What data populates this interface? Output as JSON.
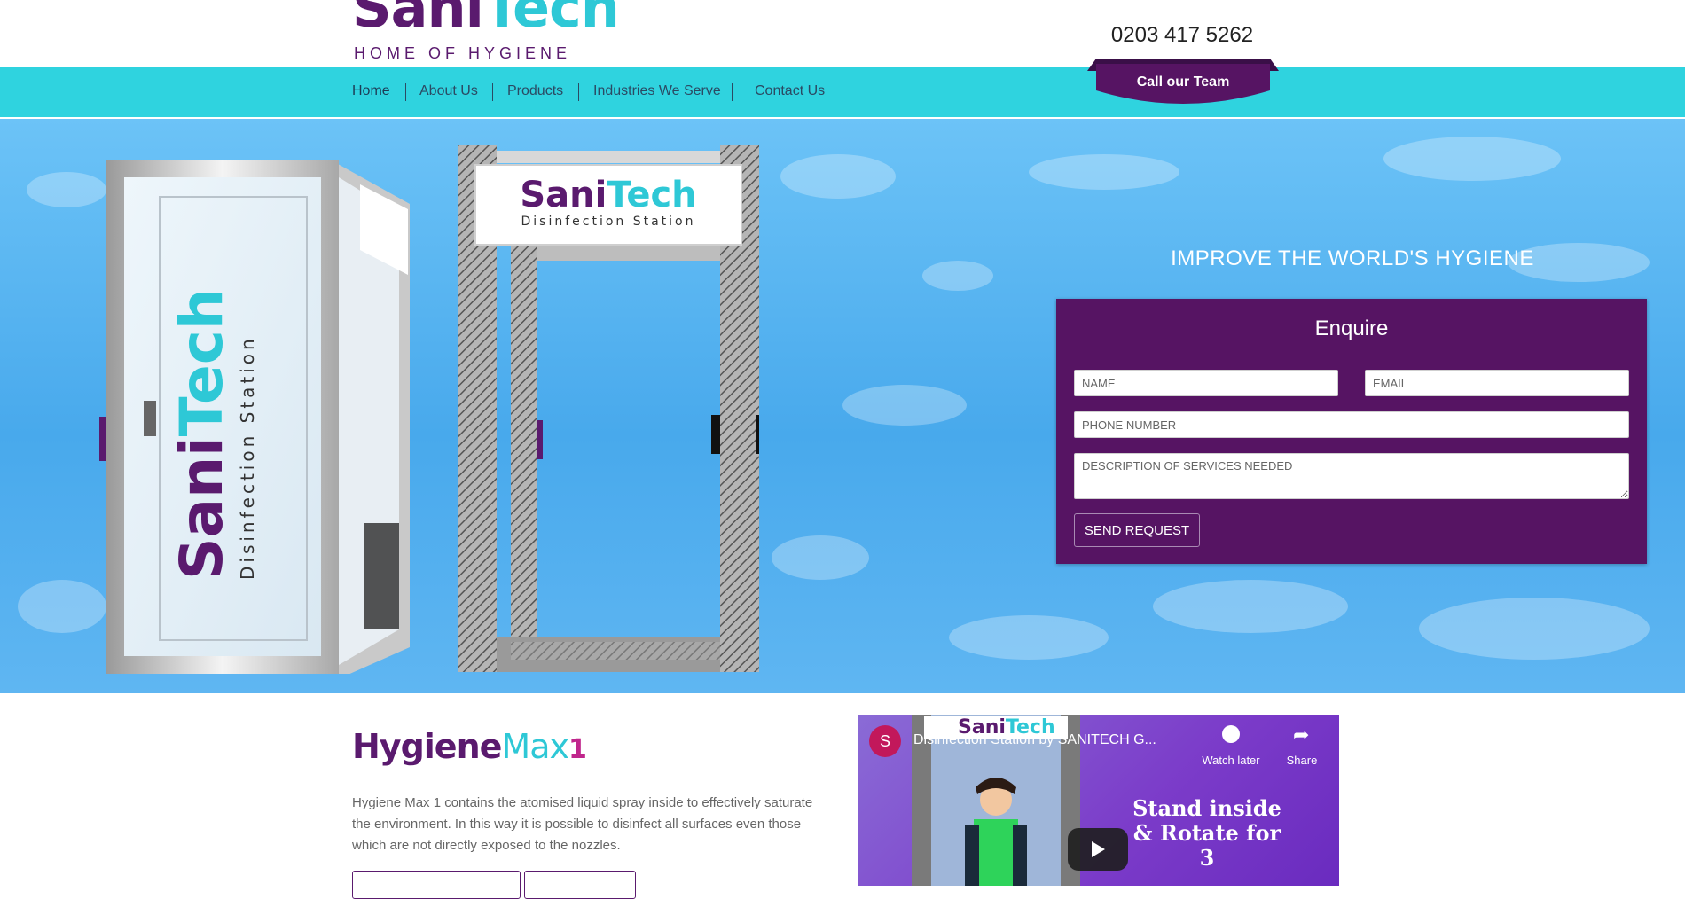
{
  "header": {
    "logo_brand_1": "Sani",
    "logo_brand_2": "Tech",
    "logo_tagline": "HOME OF HYGIENE",
    "phone": "0203 417 5262",
    "call_button": "Call our Team"
  },
  "nav": {
    "items": [
      {
        "label": "Home"
      },
      {
        "label": "About Us"
      },
      {
        "label": "Products"
      },
      {
        "label": "Industries We Serve"
      },
      {
        "label": "Contact Us"
      }
    ]
  },
  "hero": {
    "title": "IMPROVE THE WORLD'S HYGIENE",
    "booth_left": {
      "brand_1": "Sani",
      "brand_2": "Tech",
      "subtitle": "Disinfection Station"
    },
    "booth_right": {
      "brand_1": "Sani",
      "brand_2": "Tech",
      "subtitle": "Disinfection Station"
    }
  },
  "enquire": {
    "title": "Enquire",
    "name_placeholder": "NAME",
    "email_placeholder": "EMAIL",
    "phone_placeholder": "PHONE NUMBER",
    "description_placeholder": "DESCRIPTION OF SERVICES NEEDED",
    "submit_label": "SEND REQUEST"
  },
  "product": {
    "name_1": "Hygiene",
    "name_2": "Max",
    "name_3": "1",
    "description": "Hygiene Max 1 contains the atomised liquid spray inside to effectively saturate the environment. In this way it is possible to disinfect all surfaces even those which are not directly exposed to the nozzles."
  },
  "video": {
    "channel_initial": "S",
    "title": "Disinfection Station by SANITECH G...",
    "watch_later": "Watch later",
    "share": "Share",
    "caption_line1": "Stand inside",
    "caption_line2": "& Rotate for",
    "caption_line3": "3",
    "thumb_brand_1": "Sani",
    "thumb_brand_2": "Tech"
  },
  "colors": {
    "brand_purple": "#5a1a6e",
    "brand_teal": "#2ec8d6",
    "nav_bg": "#2fd3df",
    "form_bg": "#561463"
  }
}
